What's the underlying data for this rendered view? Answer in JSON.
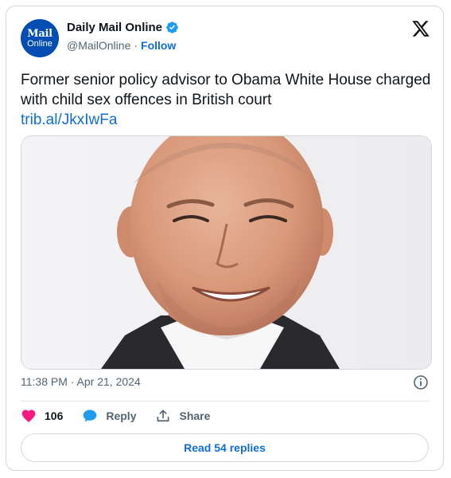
{
  "account": {
    "avatar_line1": "Mail",
    "avatar_line2": "Online",
    "display_name": "Daily Mail Online",
    "handle": "@MailOnline",
    "separator": "·",
    "follow_label": "Follow"
  },
  "tweet": {
    "text": "Former senior policy advisor to Obama White House charged with child sex offences in British court",
    "link": "trib.al/JkxIwFa",
    "timestamp": "11:38 PM · Apr 21, 2024"
  },
  "actions": {
    "likes_count": "106",
    "reply_label": "Reply",
    "share_label": "Share"
  },
  "read_replies_label": "Read 54 replies",
  "colors": {
    "brand_blue": "#004db3",
    "link_blue": "#0f6ed6",
    "like_pink": "#f91880",
    "muted_text": "#536471",
    "border": "#cfd9de"
  },
  "icons": {
    "verified": "verified-badge-icon",
    "x_logo": "x-logo-icon",
    "info": "info-icon",
    "like": "heart-icon",
    "reply": "speech-bubble-icon",
    "share": "share-upload-icon"
  }
}
